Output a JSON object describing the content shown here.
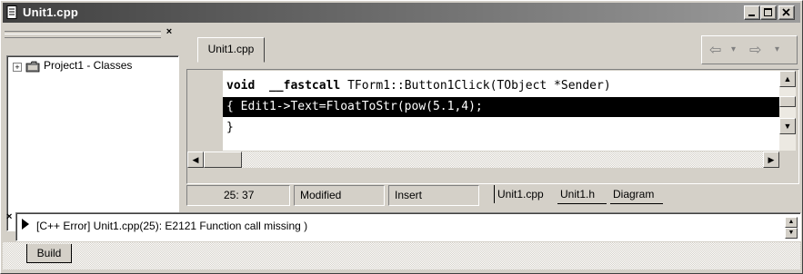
{
  "window": {
    "title": "Unit1.cpp"
  },
  "left_panel": {
    "tree": {
      "label": "Project1 - Classes",
      "expander": "+"
    }
  },
  "editor": {
    "tab": "Unit1.cpp",
    "code": {
      "line1_kw1": "void",
      "line1_kw2": "__fastcall",
      "line1_rest": " TForm1::Button1Click(TObject *Sender)",
      "line2": "{ Edit1->Text=FloatToStr(pow(5.1,4);",
      "line3": "}"
    }
  },
  "status": {
    "position": "25: 37",
    "modified": "Modified",
    "mode": "Insert",
    "tabs": [
      "Unit1.cpp",
      "Unit1.h",
      "Diagram"
    ]
  },
  "messages": {
    "error": "[C++ Error] Unit1.cpp(25): E2121 Function call missing )",
    "tab": "Build"
  },
  "icons": [
    "document-icon",
    "minimize-icon",
    "maximize-icon",
    "close-icon",
    "back-arrow-icon",
    "forward-arrow-icon",
    "folder-icon"
  ]
}
